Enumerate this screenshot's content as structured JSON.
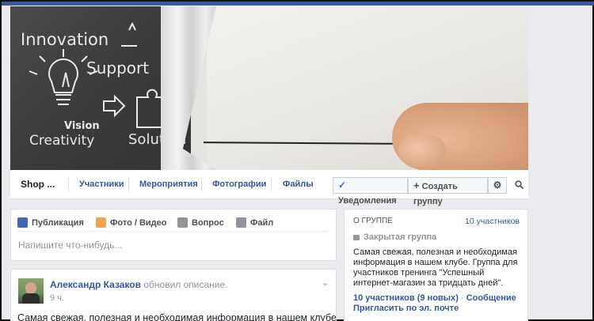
{
  "cover": {
    "chalk_words": [
      "Innovation",
      "Support",
      "Vision",
      "Creativity",
      "Solution"
    ]
  },
  "nav": {
    "group_name": "Shop ...",
    "tabs": [
      "Участники",
      "Мероприятия",
      "Фотографии",
      "Файлы"
    ],
    "notifications_label": "Уведомления",
    "create_group_label": "Создать группу"
  },
  "composer": {
    "tabs": [
      "Публикация",
      "Фото / Видео",
      "Вопрос",
      "Файл"
    ],
    "placeholder": "Напишите что-нибудь..."
  },
  "post": {
    "author": "Александр Казаков",
    "action": "обновил описание.",
    "time": "9 ч.",
    "text": "Самая свежая, полезная и необходимая информация в нашем клубе."
  },
  "about": {
    "heading": "О ГРУППЕ",
    "members_count": "10 участников",
    "privacy": "Закрытая группа",
    "description": "Самая свежая, полезная и необходимая информация в нашем клубе. Группа для участников тренинга \"Успешный интернет-магазин за тридцать дней\".",
    "members_link": "10 участников (9 новых)",
    "message_link": "Сообщение",
    "separator": "·",
    "invite_link": "Пригласить по эл. почте"
  },
  "colors": {
    "link": "#365899",
    "page_bg": "#e9ebee",
    "accent": "#3b5998"
  }
}
